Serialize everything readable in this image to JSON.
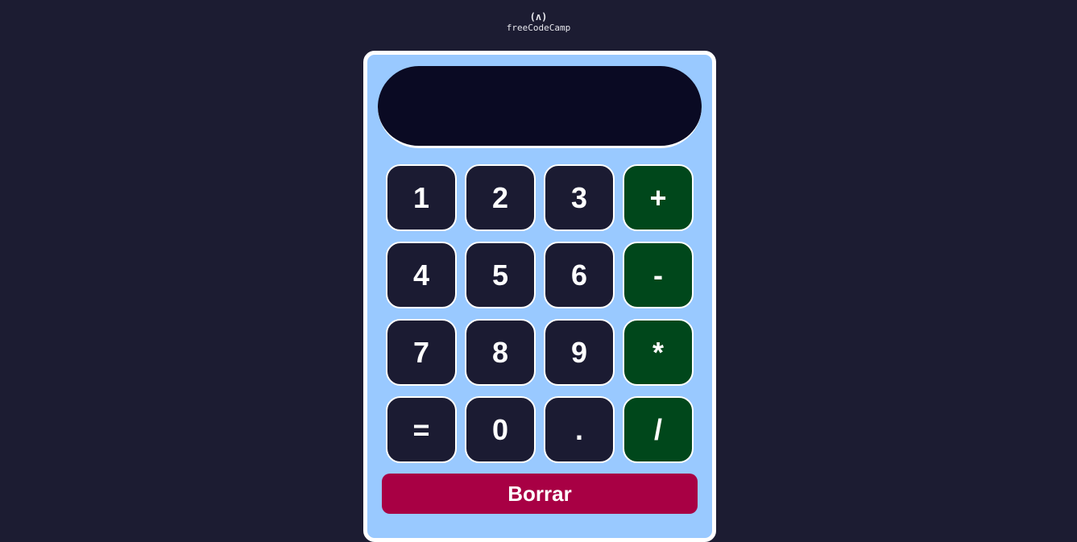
{
  "logo": {
    "mark": "(ʌ)",
    "text": "freeCodeCamp"
  },
  "display": {
    "value": ""
  },
  "keys": [
    {
      "label": "1",
      "type": "number"
    },
    {
      "label": "2",
      "type": "number"
    },
    {
      "label": "3",
      "type": "number"
    },
    {
      "label": "+",
      "type": "operator"
    },
    {
      "label": "4",
      "type": "number"
    },
    {
      "label": "5",
      "type": "number"
    },
    {
      "label": "6",
      "type": "number"
    },
    {
      "label": "-",
      "type": "operator"
    },
    {
      "label": "7",
      "type": "number"
    },
    {
      "label": "8",
      "type": "number"
    },
    {
      "label": "9",
      "type": "number"
    },
    {
      "label": "*",
      "type": "operator"
    },
    {
      "label": "=",
      "type": "number"
    },
    {
      "label": "0",
      "type": "number"
    },
    {
      "label": ".",
      "type": "number"
    },
    {
      "label": "/",
      "type": "operator"
    }
  ],
  "clear_label": "Borrar",
  "colors": {
    "page_background": "#1c1c32",
    "calculator_body": "#99c9ff",
    "screen": "#0a0a23",
    "number_key": "#1b1b32",
    "operator_key": "#00471b",
    "clear_button": "#a80044"
  }
}
